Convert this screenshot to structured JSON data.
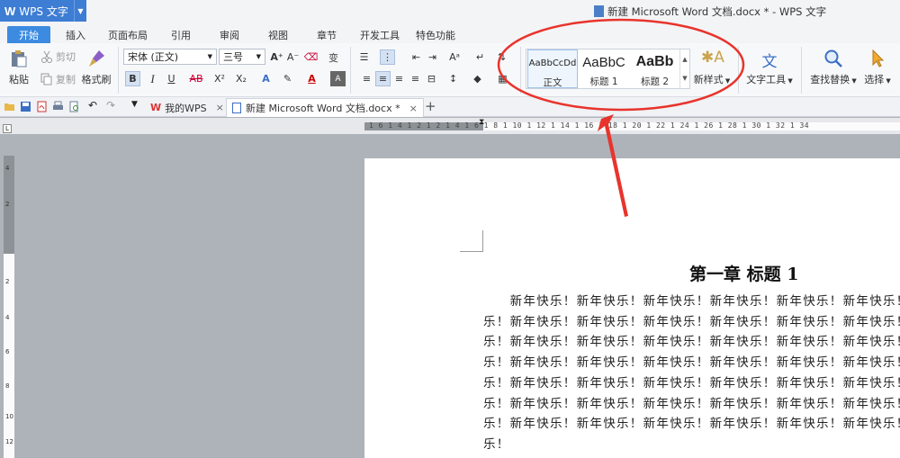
{
  "app": {
    "name": "WPS 文字",
    "window_title": "新建 Microsoft Word 文档.docx * - WPS 文字"
  },
  "tabs": [
    "开始",
    "插入",
    "页面布局",
    "引用",
    "审阅",
    "视图",
    "章节",
    "开发工具",
    "特色功能"
  ],
  "ribbon": {
    "clipboard": {
      "paste": "粘贴",
      "cut": "剪切",
      "copy": "复制",
      "format_painter": "格式刷"
    },
    "font": {
      "family": "宋体 (正文)",
      "size": "三号",
      "bold": "B",
      "italic": "I",
      "underline": "U",
      "strike": "AB",
      "superscript": "X²",
      "subscript": "X₂"
    },
    "styles": [
      {
        "preview": "AaBbCcDd",
        "name": "正文"
      },
      {
        "preview": "AaBbC",
        "name": "标题 1"
      },
      {
        "preview": "AaBb",
        "name": "标题 2"
      }
    ],
    "new_style": "新样式",
    "text_tools": "文字工具",
    "find_replace": "查找替换",
    "select": "选择"
  },
  "doc_tabs": [
    {
      "label": "我的WPS",
      "close": "×"
    },
    {
      "label": "新建 Microsoft Word 文档.docx *",
      "close": "×"
    }
  ],
  "new_tab": "+",
  "ruler": {
    "h_numbers": "1 6 1 4 1 2 1 2 1 4 1 6 1 8 1 10 1 12 1 14 1 16 1 18 1 20 1 22 1 24 1 26 1 28 1 30 1 32 1 34",
    "v_numbers": [
      "4",
      "2",
      "2",
      "4",
      "6",
      "8",
      "10",
      "12"
    ]
  },
  "document": {
    "heading": "第一章  标题 1",
    "lines": [
      "　　新年快乐！新年快乐！新年快乐！新年快乐！新年快乐！新年快乐！",
      "乐！新年快乐！新年快乐！新年快乐！新年快乐！新年快乐！新年快乐！",
      "乐！新年快乐！新年快乐！新年快乐！新年快乐！新年快乐！新年快乐！",
      "乐！新年快乐！新年快乐！新年快乐！新年快乐！新年快乐！新年快乐！",
      "乐！新年快乐！新年快乐！新年快乐！新年快乐！新年快乐！新年快乐！",
      "乐！新年快乐！新年快乐！新年快乐！新年快乐！新年快乐！新年快乐！",
      "乐！新年快乐！新年快乐！新年快乐！新年快乐！新年快乐！新年快乐！",
      "乐！"
    ]
  },
  "colors": {
    "accent": "#3c8be0",
    "annotation": "#e8342c"
  }
}
